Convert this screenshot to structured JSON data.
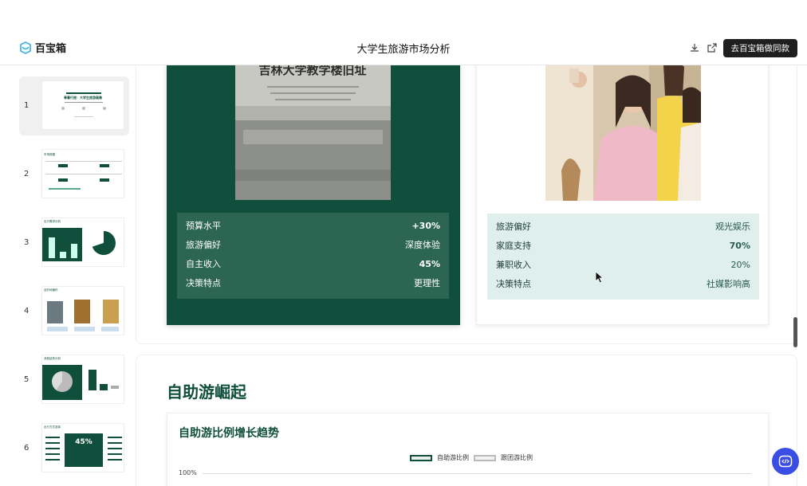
{
  "app": {
    "brand": "百宝箱",
    "title": "大学生旅游市场分析",
    "cta": "去百宝箱做同款"
  },
  "thumbnails": [
    {
      "num": "1",
      "caption": "青春行旅：大学生旅游画像"
    },
    {
      "num": "2",
      "caption": "市场规模"
    },
    {
      "num": "3",
      "caption": "出行需求分析"
    },
    {
      "num": "4",
      "caption": "目的地偏好"
    },
    {
      "num": "5",
      "caption": "消费结构分析"
    },
    {
      "num": "6",
      "caption": "出行方式选择",
      "big": "45%"
    }
  ],
  "cards": {
    "left": {
      "photo_text": "吉林大学教学楼旧址",
      "rows": [
        {
          "label": "预算水平",
          "value": "+30%"
        },
        {
          "label": "旅游偏好",
          "value": "深度体验"
        },
        {
          "label": "自主收入",
          "value": "45%"
        },
        {
          "label": "决策特点",
          "value": "更理性"
        }
      ]
    },
    "right": {
      "rows": [
        {
          "label": "旅游偏好",
          "value": "观光娱乐"
        },
        {
          "label": "家庭支持",
          "value": "70%"
        },
        {
          "label": "兼职收入",
          "value": "20%"
        },
        {
          "label": "决策特点",
          "value": "社媒影响高"
        }
      ]
    }
  },
  "section": {
    "heading": "自助游崛起",
    "chart": {
      "title": "自助游比例增长趋势",
      "legend": [
        "自助游比例",
        "跟团游比例"
      ],
      "ytick": "100%"
    }
  },
  "chart_data": {
    "type": "line",
    "title": "自助游比例增长趋势",
    "series": [
      {
        "name": "自助游比例"
      },
      {
        "name": "跟团游比例"
      }
    ],
    "y_tick_labels": [
      "100%"
    ]
  },
  "colors": {
    "accent": "#0f4f3c",
    "fab": "#3a4ee6"
  },
  "icons": [
    "download-icon",
    "external-link-icon",
    "code-icon",
    "cursor-icon"
  ]
}
